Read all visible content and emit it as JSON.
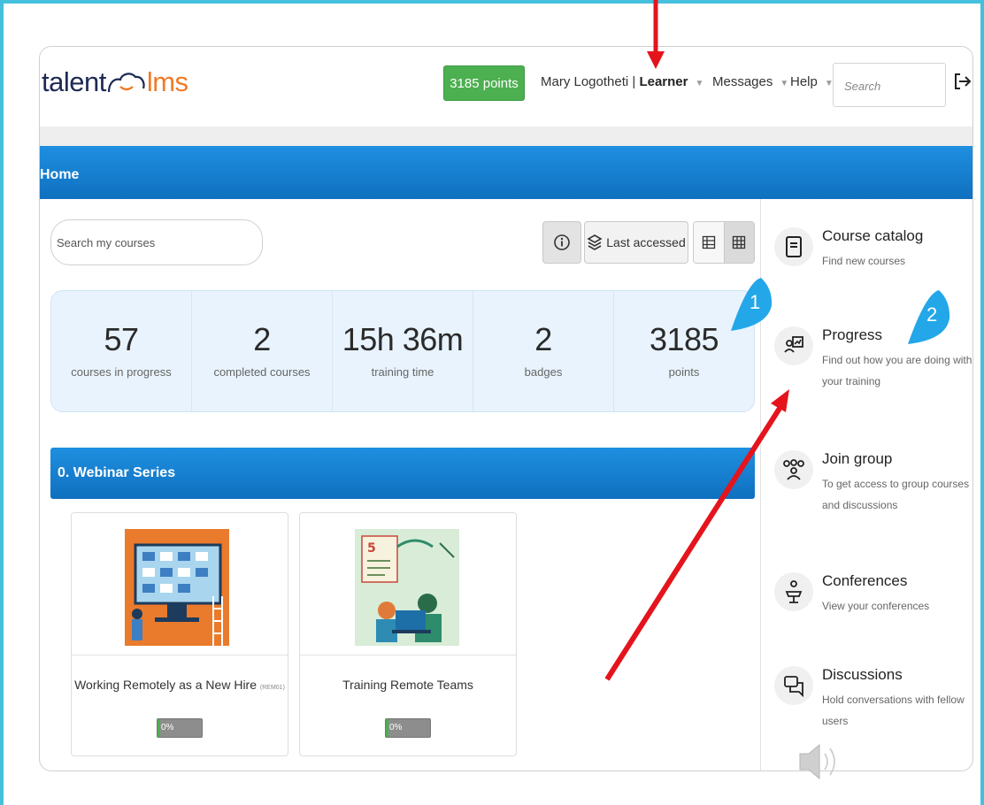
{
  "header": {
    "logo_left": "talent",
    "logo_right": "lms",
    "points_badge": "3185 points",
    "user_name": "Mary Logotheti | ",
    "user_role": "Learner",
    "messages": "Messages",
    "help": "Help",
    "search_placeholder": "Search",
    "logout_icon": "logout-icon"
  },
  "home": {
    "title": "Home"
  },
  "toolbar": {
    "course_search_placeholder": "Search my courses",
    "sort_label": "Last accessed",
    "info_icon": "info-icon",
    "layers_icon": "layers-icon",
    "list_view_icon": "list-view-icon",
    "grid_view_icon": "grid-view-icon"
  },
  "stats": [
    {
      "value": "57",
      "label": "courses in progress"
    },
    {
      "value": "2",
      "label": "completed courses"
    },
    {
      "value": "15h 36m",
      "label": "training time"
    },
    {
      "value": "2",
      "label": "badges"
    },
    {
      "value": "3185",
      "label": "points"
    }
  ],
  "series": {
    "title": "0. Webinar Series",
    "courses": [
      {
        "title": "Working Remotely as a New Hire",
        "code": "(REM01)",
        "progress_label": "0%",
        "progress": 0
      },
      {
        "title": "Training Remote Teams",
        "code": "",
        "progress_label": "0%",
        "progress": 0
      }
    ]
  },
  "right_panel": [
    {
      "title": "Course catalog",
      "desc": "Find new courses",
      "icon": "book-icon"
    },
    {
      "title": "Progress",
      "desc": "Find out how you are doing with your training",
      "icon": "progress-icon"
    },
    {
      "title": "Join group",
      "desc": "To get access to group courses and discussions",
      "icon": "group-icon"
    },
    {
      "title": "Conferences",
      "desc": "View your conferences",
      "icon": "podium-icon"
    },
    {
      "title": "Discussions",
      "desc": "Hold conversations with fellow users",
      "icon": "chat-icon"
    }
  ],
  "callouts": {
    "one": "1",
    "two": "2"
  },
  "colors": {
    "accent_blue": "#1a82d4",
    "points_green": "#4caf50",
    "callout_blue": "#23a7e8",
    "annotation_red": "#e5141c",
    "slide_border": "#45c0dc"
  }
}
